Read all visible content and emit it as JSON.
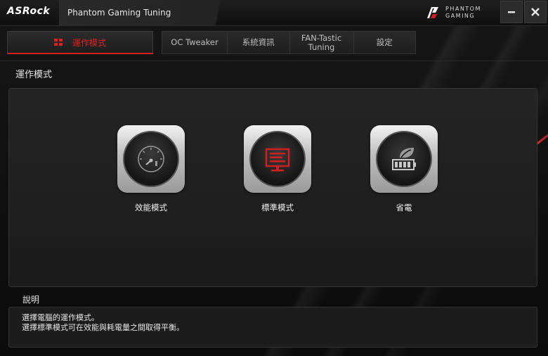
{
  "window": {
    "logo": "ASRock",
    "app_title": "Phantom Gaming Tuning",
    "brand_line1": "PHANTOM",
    "brand_line2": "GAMING",
    "icons": [
      "minimize-icon",
      "close-icon"
    ]
  },
  "tabs": {
    "active_label": "運作模式",
    "items": [
      {
        "label": "OC Tweaker"
      },
      {
        "label": "系統資訊"
      },
      {
        "label": "FAN-Tastic\nTuning"
      },
      {
        "label": "設定"
      }
    ]
  },
  "main": {
    "section_title": "運作模式",
    "modes": [
      {
        "label": "效能模式",
        "icon": "speedometer-icon"
      },
      {
        "label": "標準模式",
        "icon": "monitor-icon"
      },
      {
        "label": "省電",
        "icon": "leaf-battery-icon"
      }
    ]
  },
  "description": {
    "title": "說明",
    "lines": [
      "選擇電腦的運作模式。",
      "選擇標準模式可在效能與耗電量之間取得平衡。"
    ]
  },
  "colors": {
    "accent": "#d11f1f",
    "background": "#0d0d0d"
  }
}
